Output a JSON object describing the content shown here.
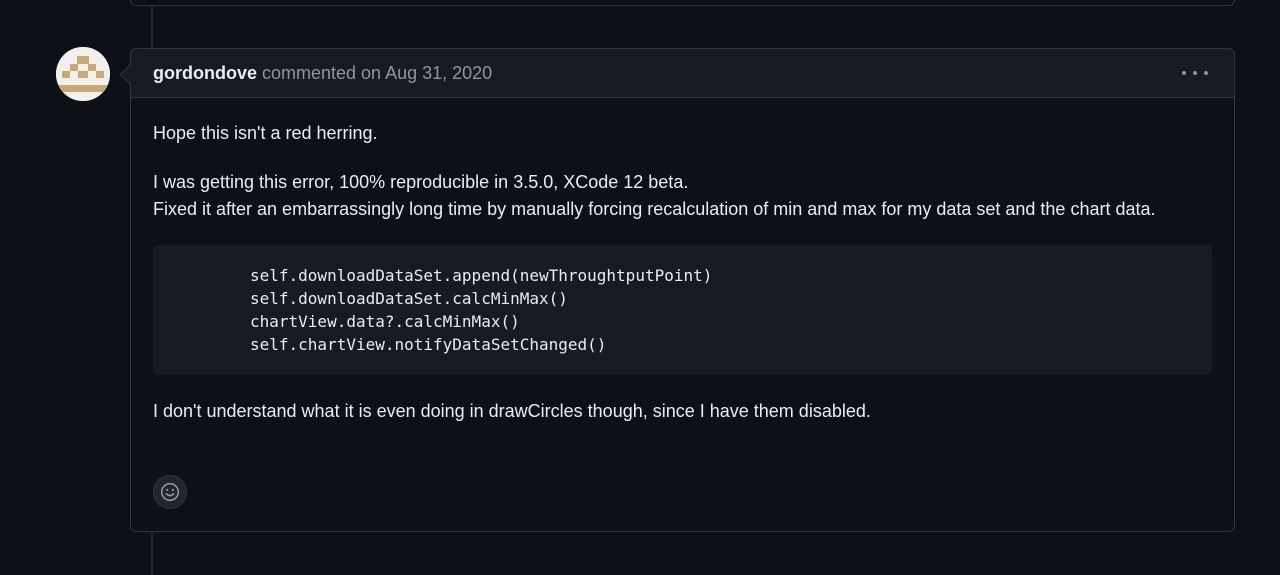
{
  "comment": {
    "author": "gordondove",
    "meta": "commented on Aug 31, 2020",
    "paragraph1": "Hope this isn't a red herring.",
    "paragraph2_line1": "I was getting this error, 100% reproducible in 3.5.0, XCode 12 beta.",
    "paragraph2_line2": "Fixed it after an embarrassingly long time by manually forcing recalculation of min and max for my data set and the chart data.",
    "code_lines": [
      "self.downloadDataSet.append(newThroughtputPoint)",
      "self.downloadDataSet.calcMinMax()",
      "chartView.data?.calcMinMax()",
      "self.chartView.notifyDataSetChanged()"
    ],
    "paragraph3": "I don't understand what it is even doing in drawCircles though, since I have them disabled."
  },
  "icons": {
    "avatar": "identicon-avatar",
    "more": "kebab-horizontal-icon",
    "reaction": "smiley-icon"
  },
  "colors": {
    "background": "#0d1117",
    "header": "#161b22",
    "border": "#30363d",
    "muted_text": "#8d96a0",
    "avatar_accent": "#c9a97a"
  }
}
